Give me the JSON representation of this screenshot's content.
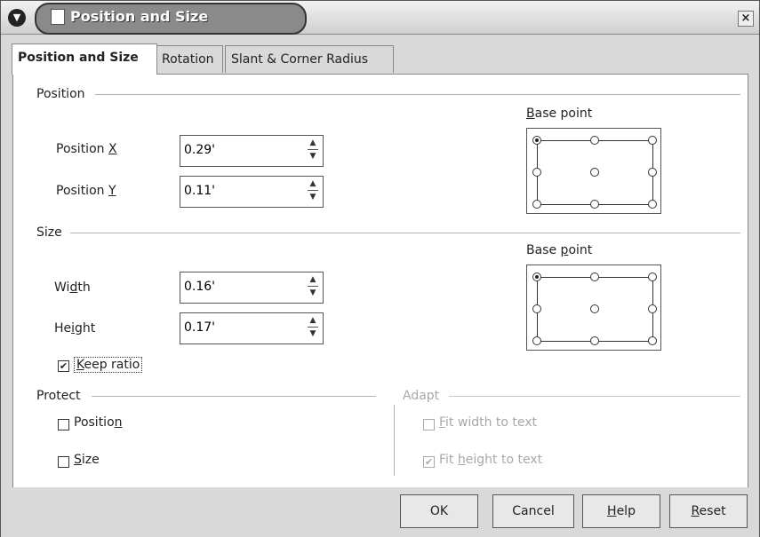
{
  "window": {
    "title": "Position and Size"
  },
  "tabs": [
    {
      "label": "Position and Size"
    },
    {
      "label": "Rotation"
    },
    {
      "label": "Slant & Corner Radius"
    }
  ],
  "position": {
    "heading": "Position",
    "x_label_pre": "Position ",
    "x_label_key": "X",
    "x_value": "0.29'",
    "y_label_pre": "Position ",
    "y_label_key": "Y",
    "y_value": "0.11'",
    "base_point_label_key": "B",
    "base_point_label_rest": "ase point"
  },
  "size": {
    "heading": "Size",
    "width_label_pre": "Wi",
    "width_label_key": "d",
    "width_label_post": "th",
    "width_value": "0.16'",
    "height_label_pre": "He",
    "height_label_key": "i",
    "height_label_post": "ght",
    "height_value": "0.17'",
    "keep_ratio_key": "K",
    "keep_ratio_rest": "eep ratio",
    "keep_ratio_checked": true,
    "base_point_label_pre": "Base ",
    "base_point_label_key": "p",
    "base_point_label_post": "oint"
  },
  "protect": {
    "heading": "Protect",
    "position_pre": "Positio",
    "position_key": "n",
    "size_key": "S",
    "size_rest": "ize"
  },
  "adapt": {
    "heading": "Adapt",
    "fit_width_key": "F",
    "fit_width_rest": "it width to text",
    "fit_height_pre": "Fit ",
    "fit_height_key": "h",
    "fit_height_post": "eight to text"
  },
  "buttons": {
    "ok": "OK",
    "cancel": "Cancel",
    "help_key": "H",
    "help_rest": "elp",
    "reset_key": "R",
    "reset_rest": "eset"
  }
}
